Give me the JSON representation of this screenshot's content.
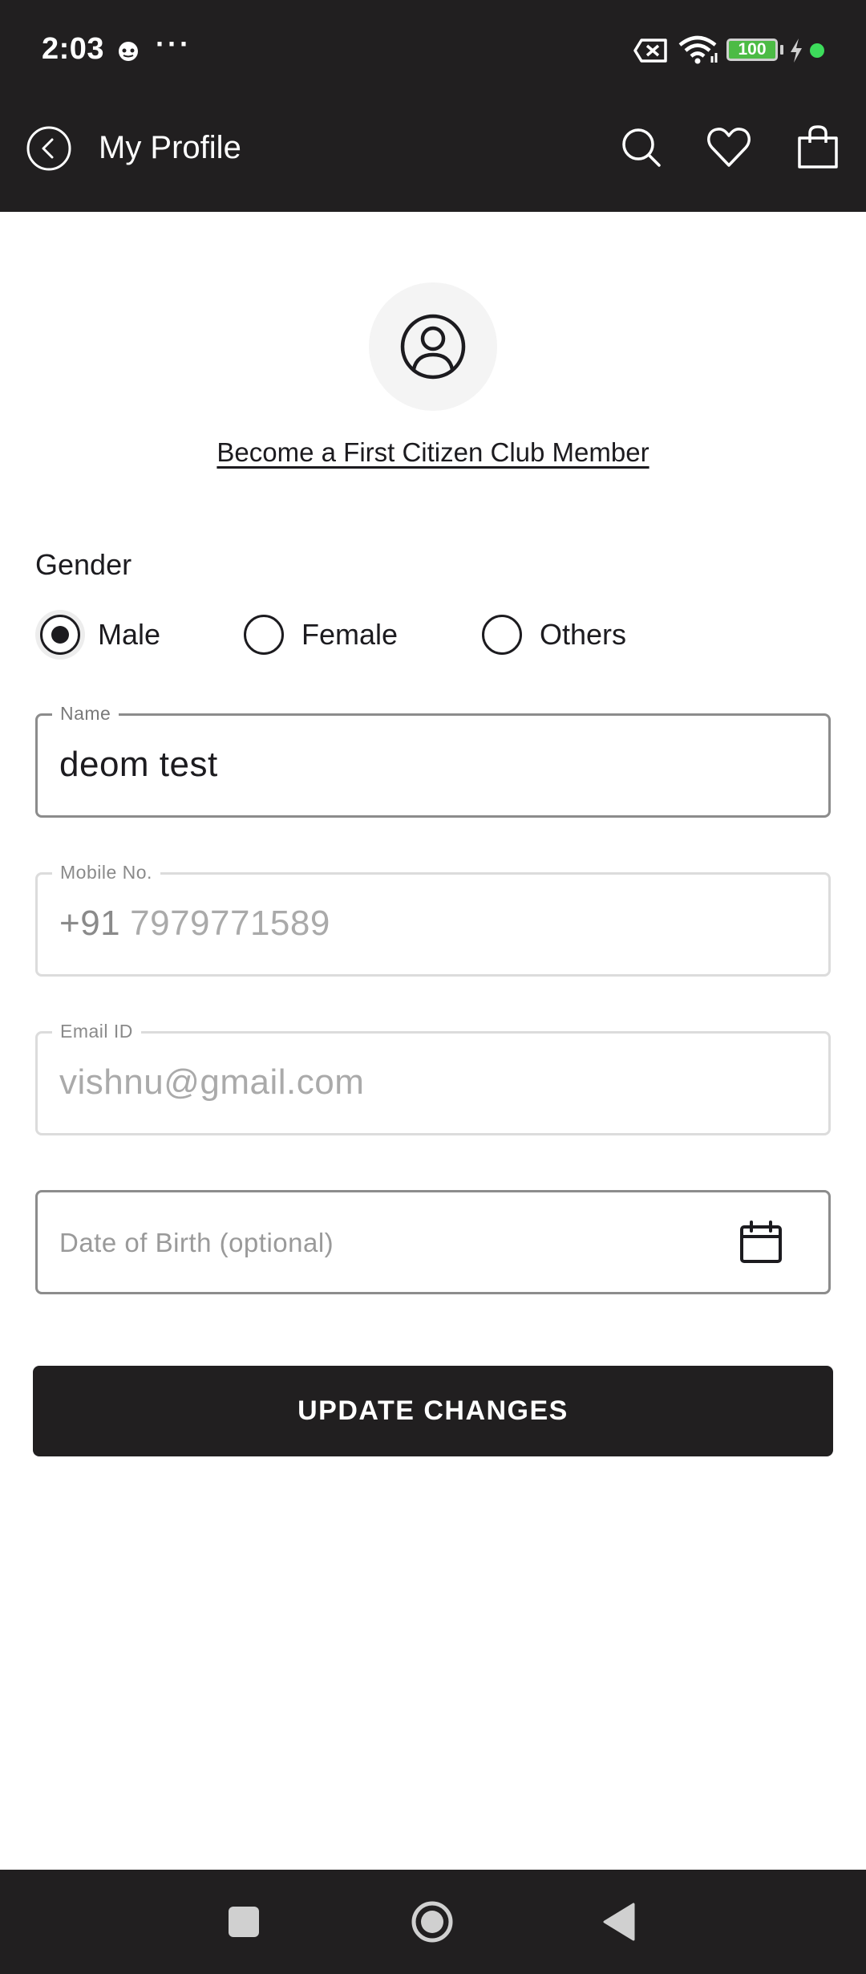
{
  "status_bar": {
    "time": "2:03",
    "more": "···",
    "battery": "100"
  },
  "app_bar": {
    "title": "My Profile"
  },
  "profile": {
    "club_link": "Become a First Citizen Club Member"
  },
  "gender": {
    "label": "Gender",
    "options": [
      {
        "label": "Male",
        "selected": true
      },
      {
        "label": "Female",
        "selected": false
      },
      {
        "label": "Others",
        "selected": false
      }
    ]
  },
  "fields": {
    "name": {
      "label": "Name",
      "value": "deom test"
    },
    "mobile": {
      "label": "Mobile No.",
      "prefix": "+91",
      "value": "7979771589"
    },
    "email": {
      "label": "Email ID",
      "value": "vishnu@gmail.com"
    },
    "dob": {
      "placeholder": "Date of Birth (optional)"
    }
  },
  "actions": {
    "update": "UPDATE CHANGES"
  },
  "colors": {
    "bar_background": "#211f20",
    "battery_green": "#4cbb45",
    "notification_dot": "#3ddc5b"
  }
}
